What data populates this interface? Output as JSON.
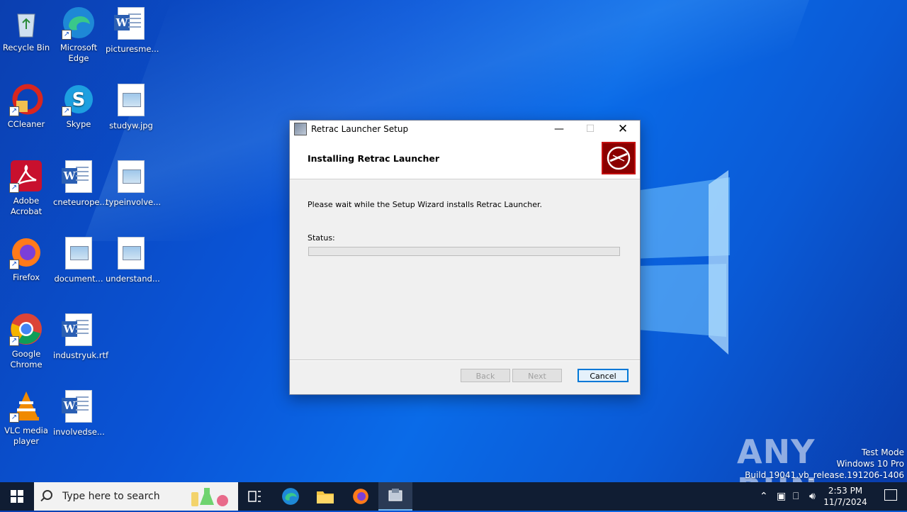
{
  "desktop": {
    "icons": [
      {
        "label": "Recycle Bin"
      },
      {
        "label": "Microsoft Edge"
      },
      {
        "label": "picturesme..."
      },
      {
        "label": "CCleaner"
      },
      {
        "label": "Skype"
      },
      {
        "label": "studyw.jpg"
      },
      {
        "label": "Adobe Acrobat"
      },
      {
        "label": "cneteurope..."
      },
      {
        "label": "typeinvolve..."
      },
      {
        "label": "Firefox"
      },
      {
        "label": "document..."
      },
      {
        "label": "understand..."
      },
      {
        "label": "Google Chrome"
      },
      {
        "label": "industryuk.rtf"
      },
      {
        "label": "VLC media player"
      },
      {
        "label": "involvedse..."
      }
    ]
  },
  "dialog": {
    "window_title": "Retrac Launcher Setup",
    "heading": "Installing Retrac Launcher",
    "description": "Please wait while the Setup Wizard installs Retrac Launcher.",
    "status_label": "Status:",
    "progress_fraction": 0,
    "buttons": {
      "back": "Back",
      "next": "Next",
      "cancel": "Cancel"
    }
  },
  "taskbar": {
    "search_placeholder": "Type here to search",
    "clock_time": "2:53 PM",
    "clock_date": "11/7/2024"
  },
  "watermark": {
    "brand": "ANY RUN",
    "line1": "Test Mode",
    "line2": "Windows 10 Pro",
    "line3": "Build 19041.vb_release.191206-1406"
  },
  "colors": {
    "accent": "#0078d7",
    "taskbar": "#101d33",
    "banner_red": "#8b0000"
  }
}
